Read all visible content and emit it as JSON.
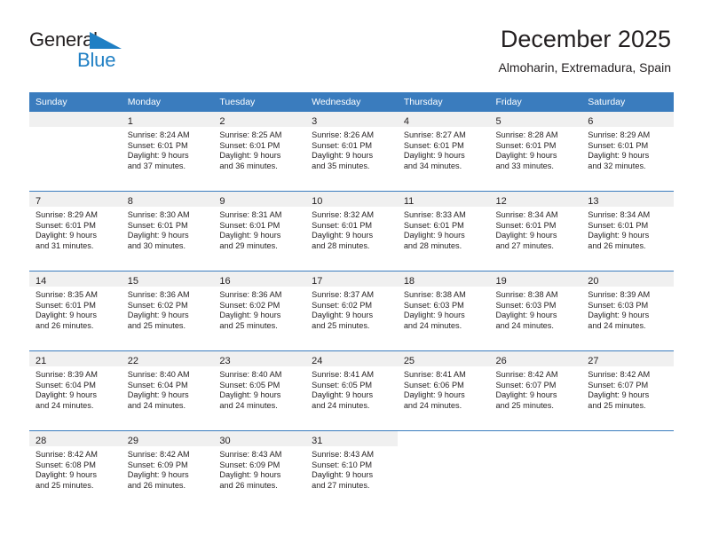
{
  "brand": {
    "name_part1": "General",
    "name_part2": "Blue",
    "accent_color": "#1f7fc4"
  },
  "header": {
    "title": "December 2025",
    "subtitle": "Almoharin, Extremadura, Spain"
  },
  "calendar": {
    "header_bg": "#3A7CBE",
    "daynum_bg": "#F0F0F0",
    "weekdays": [
      "Sunday",
      "Monday",
      "Tuesday",
      "Wednesday",
      "Thursday",
      "Friday",
      "Saturday"
    ],
    "weeks": [
      [
        {
          "day": "",
          "lines": []
        },
        {
          "day": "1",
          "lines": [
            "Sunrise: 8:24 AM",
            "Sunset: 6:01 PM",
            "Daylight: 9 hours",
            "and 37 minutes."
          ]
        },
        {
          "day": "2",
          "lines": [
            "Sunrise: 8:25 AM",
            "Sunset: 6:01 PM",
            "Daylight: 9 hours",
            "and 36 minutes."
          ]
        },
        {
          "day": "3",
          "lines": [
            "Sunrise: 8:26 AM",
            "Sunset: 6:01 PM",
            "Daylight: 9 hours",
            "and 35 minutes."
          ]
        },
        {
          "day": "4",
          "lines": [
            "Sunrise: 8:27 AM",
            "Sunset: 6:01 PM",
            "Daylight: 9 hours",
            "and 34 minutes."
          ]
        },
        {
          "day": "5",
          "lines": [
            "Sunrise: 8:28 AM",
            "Sunset: 6:01 PM",
            "Daylight: 9 hours",
            "and 33 minutes."
          ]
        },
        {
          "day": "6",
          "lines": [
            "Sunrise: 8:29 AM",
            "Sunset: 6:01 PM",
            "Daylight: 9 hours",
            "and 32 minutes."
          ]
        }
      ],
      [
        {
          "day": "7",
          "lines": [
            "Sunrise: 8:29 AM",
            "Sunset: 6:01 PM",
            "Daylight: 9 hours",
            "and 31 minutes."
          ]
        },
        {
          "day": "8",
          "lines": [
            "Sunrise: 8:30 AM",
            "Sunset: 6:01 PM",
            "Daylight: 9 hours",
            "and 30 minutes."
          ]
        },
        {
          "day": "9",
          "lines": [
            "Sunrise: 8:31 AM",
            "Sunset: 6:01 PM",
            "Daylight: 9 hours",
            "and 29 minutes."
          ]
        },
        {
          "day": "10",
          "lines": [
            "Sunrise: 8:32 AM",
            "Sunset: 6:01 PM",
            "Daylight: 9 hours",
            "and 28 minutes."
          ]
        },
        {
          "day": "11",
          "lines": [
            "Sunrise: 8:33 AM",
            "Sunset: 6:01 PM",
            "Daylight: 9 hours",
            "and 28 minutes."
          ]
        },
        {
          "day": "12",
          "lines": [
            "Sunrise: 8:34 AM",
            "Sunset: 6:01 PM",
            "Daylight: 9 hours",
            "and 27 minutes."
          ]
        },
        {
          "day": "13",
          "lines": [
            "Sunrise: 8:34 AM",
            "Sunset: 6:01 PM",
            "Daylight: 9 hours",
            "and 26 minutes."
          ]
        }
      ],
      [
        {
          "day": "14",
          "lines": [
            "Sunrise: 8:35 AM",
            "Sunset: 6:01 PM",
            "Daylight: 9 hours",
            "and 26 minutes."
          ]
        },
        {
          "day": "15",
          "lines": [
            "Sunrise: 8:36 AM",
            "Sunset: 6:02 PM",
            "Daylight: 9 hours",
            "and 25 minutes."
          ]
        },
        {
          "day": "16",
          "lines": [
            "Sunrise: 8:36 AM",
            "Sunset: 6:02 PM",
            "Daylight: 9 hours",
            "and 25 minutes."
          ]
        },
        {
          "day": "17",
          "lines": [
            "Sunrise: 8:37 AM",
            "Sunset: 6:02 PM",
            "Daylight: 9 hours",
            "and 25 minutes."
          ]
        },
        {
          "day": "18",
          "lines": [
            "Sunrise: 8:38 AM",
            "Sunset: 6:03 PM",
            "Daylight: 9 hours",
            "and 24 minutes."
          ]
        },
        {
          "day": "19",
          "lines": [
            "Sunrise: 8:38 AM",
            "Sunset: 6:03 PM",
            "Daylight: 9 hours",
            "and 24 minutes."
          ]
        },
        {
          "day": "20",
          "lines": [
            "Sunrise: 8:39 AM",
            "Sunset: 6:03 PM",
            "Daylight: 9 hours",
            "and 24 minutes."
          ]
        }
      ],
      [
        {
          "day": "21",
          "lines": [
            "Sunrise: 8:39 AM",
            "Sunset: 6:04 PM",
            "Daylight: 9 hours",
            "and 24 minutes."
          ]
        },
        {
          "day": "22",
          "lines": [
            "Sunrise: 8:40 AM",
            "Sunset: 6:04 PM",
            "Daylight: 9 hours",
            "and 24 minutes."
          ]
        },
        {
          "day": "23",
          "lines": [
            "Sunrise: 8:40 AM",
            "Sunset: 6:05 PM",
            "Daylight: 9 hours",
            "and 24 minutes."
          ]
        },
        {
          "day": "24",
          "lines": [
            "Sunrise: 8:41 AM",
            "Sunset: 6:05 PM",
            "Daylight: 9 hours",
            "and 24 minutes."
          ]
        },
        {
          "day": "25",
          "lines": [
            "Sunrise: 8:41 AM",
            "Sunset: 6:06 PM",
            "Daylight: 9 hours",
            "and 24 minutes."
          ]
        },
        {
          "day": "26",
          "lines": [
            "Sunrise: 8:42 AM",
            "Sunset: 6:07 PM",
            "Daylight: 9 hours",
            "and 25 minutes."
          ]
        },
        {
          "day": "27",
          "lines": [
            "Sunrise: 8:42 AM",
            "Sunset: 6:07 PM",
            "Daylight: 9 hours",
            "and 25 minutes."
          ]
        }
      ],
      [
        {
          "day": "28",
          "lines": [
            "Sunrise: 8:42 AM",
            "Sunset: 6:08 PM",
            "Daylight: 9 hours",
            "and 25 minutes."
          ]
        },
        {
          "day": "29",
          "lines": [
            "Sunrise: 8:42 AM",
            "Sunset: 6:09 PM",
            "Daylight: 9 hours",
            "and 26 minutes."
          ]
        },
        {
          "day": "30",
          "lines": [
            "Sunrise: 8:43 AM",
            "Sunset: 6:09 PM",
            "Daylight: 9 hours",
            "and 26 minutes."
          ]
        },
        {
          "day": "31",
          "lines": [
            "Sunrise: 8:43 AM",
            "Sunset: 6:10 PM",
            "Daylight: 9 hours",
            "and 27 minutes."
          ]
        },
        {
          "day": "",
          "lines": []
        },
        {
          "day": "",
          "lines": []
        },
        {
          "day": "",
          "lines": []
        }
      ]
    ]
  }
}
